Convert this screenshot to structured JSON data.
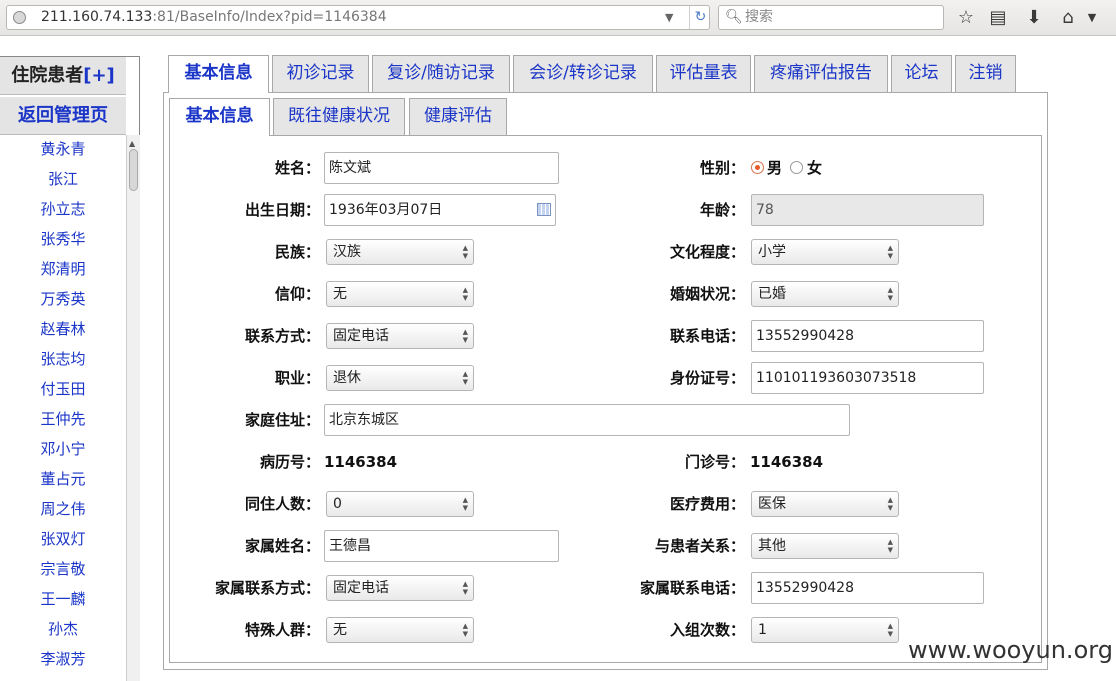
{
  "browser": {
    "url_host": "211.160.74.133",
    "url_rest": ":81/BaseInfo/Index?pid=1146384",
    "search_placeholder": "搜索"
  },
  "sidebar": {
    "header_title": "住院患者",
    "header_add": "[+]",
    "back_label": "返回管理页",
    "patients": [
      "黄永青",
      "张江",
      "孙立志",
      "张秀华",
      "郑清明",
      "万秀英",
      "赵春林",
      "张志均",
      "付玉田",
      "王仲先",
      "邓小宁",
      "董占元",
      "周之伟",
      "张双灯",
      "宗言敬",
      "王一麟",
      "孙杰",
      "李淑芳"
    ]
  },
  "main_tabs": [
    "基本信息",
    "初诊记录",
    "复诊/随访记录",
    "会诊/转诊记录",
    "评估量表",
    "疼痛评估报告",
    "论坛",
    "注销"
  ],
  "sub_tabs": [
    "基本信息",
    "既往健康状况",
    "健康评估"
  ],
  "form": {
    "name_label": "姓名：",
    "name_value": "陈文斌",
    "gender_label": "性别：",
    "gender_male": "男",
    "gender_female": "女",
    "birth_label": "出生日期：",
    "birth_value": "1936年03月07日",
    "age_label": "年龄：",
    "age_value": "78",
    "ethnicity_label": "民族：",
    "ethnicity_value": "汉族",
    "education_label": "文化程度：",
    "education_value": "小学",
    "religion_label": "信仰：",
    "religion_value": "无",
    "marital_label": "婚姻状况：",
    "marital_value": "已婚",
    "contact_label": "联系方式：",
    "contact_value": "固定电话",
    "phone_label": "联系电话：",
    "phone_value": "13552990428",
    "job_label": "职业：",
    "job_value": "退休",
    "idcard_label": "身份证号：",
    "idcard_value": "110101193603073518",
    "address_label": "家庭住址：",
    "address_value": "北京东城区",
    "record_label": "病历号：",
    "record_value": "1146384",
    "clinic_label": "门诊号：",
    "clinic_value": "1146384",
    "cohabit_label": "同住人数：",
    "cohabit_value": "0",
    "cost_label": "医疗费用：",
    "cost_value": "医保",
    "family_name_label": "家属姓名：",
    "family_name_value": "王德昌",
    "relation_label": "与患者关系：",
    "relation_value": "其他",
    "family_contact_label": "家属联系方式：",
    "family_contact_value": "固定电话",
    "family_phone_label": "家属联系电话：",
    "family_phone_value": "13552990428",
    "special_label": "特殊人群：",
    "special_value": "无",
    "group_label": "入组次数：",
    "group_value": "1"
  },
  "watermark": "www.wooyun.org",
  "colors": {
    "link_blue": "#1a35c7",
    "radio_selected": "#e65a2a"
  }
}
